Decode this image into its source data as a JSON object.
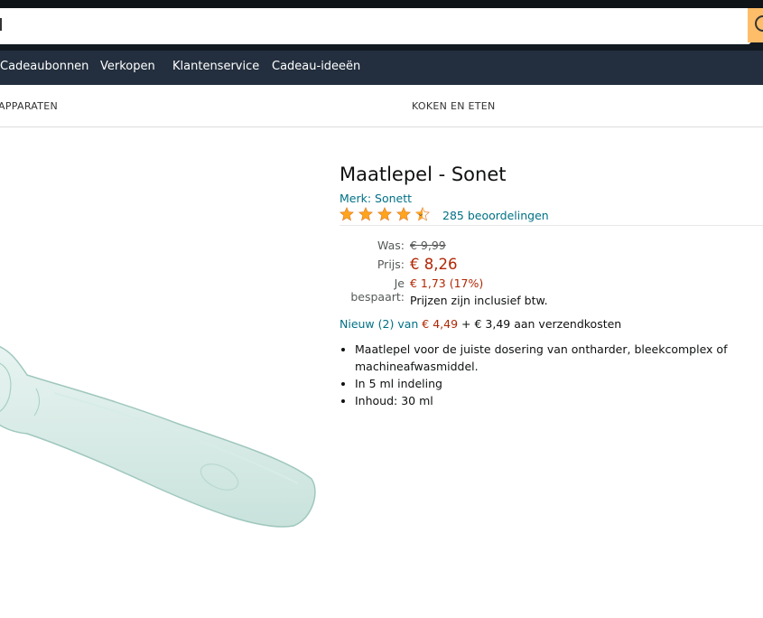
{
  "search": {
    "placeholder": ""
  },
  "nav": {
    "items": [
      "Cadeaubonnen",
      "Verkopen",
      "Klantenservice",
      "Cadeau-ideeën"
    ]
  },
  "categories": [
    "APPARATEN",
    "KOKEN EN ETEN"
  ],
  "product": {
    "title": "Maatlepel - Sonet",
    "brand": "Merk: Sonett",
    "rating": 4.5,
    "ratings_count": "285 beoordelingen",
    "was_label": "Was:",
    "was_price": "€ 9,99",
    "price_label": "Prijs:",
    "price": "€ 8,26",
    "save_label": "Je bespaart:",
    "save_value": "€ 1,73 (17%)",
    "vat_note": "Prijzen zijn inclusief btw.",
    "offers": {
      "new_link": "Nieuw (2) van",
      "new_price": "€ 4,49",
      "shipping": "+ € 3,49 aan verzendkosten"
    },
    "bullets": [
      "Maatlepel voor de juiste dosering van ontharder, bleekcomplex of machineafwasmiddel.",
      "In 5 ml indeling",
      "Inhoud: 30 ml"
    ]
  },
  "colors": {
    "header": "#131921",
    "navbar": "#232f3e",
    "link": "#007185",
    "price": "#b12704",
    "star": "#ffa41c",
    "search_button": "#febd69"
  },
  "icons": [
    "search-icon",
    "star-icon",
    "chevron-down-icon"
  ]
}
